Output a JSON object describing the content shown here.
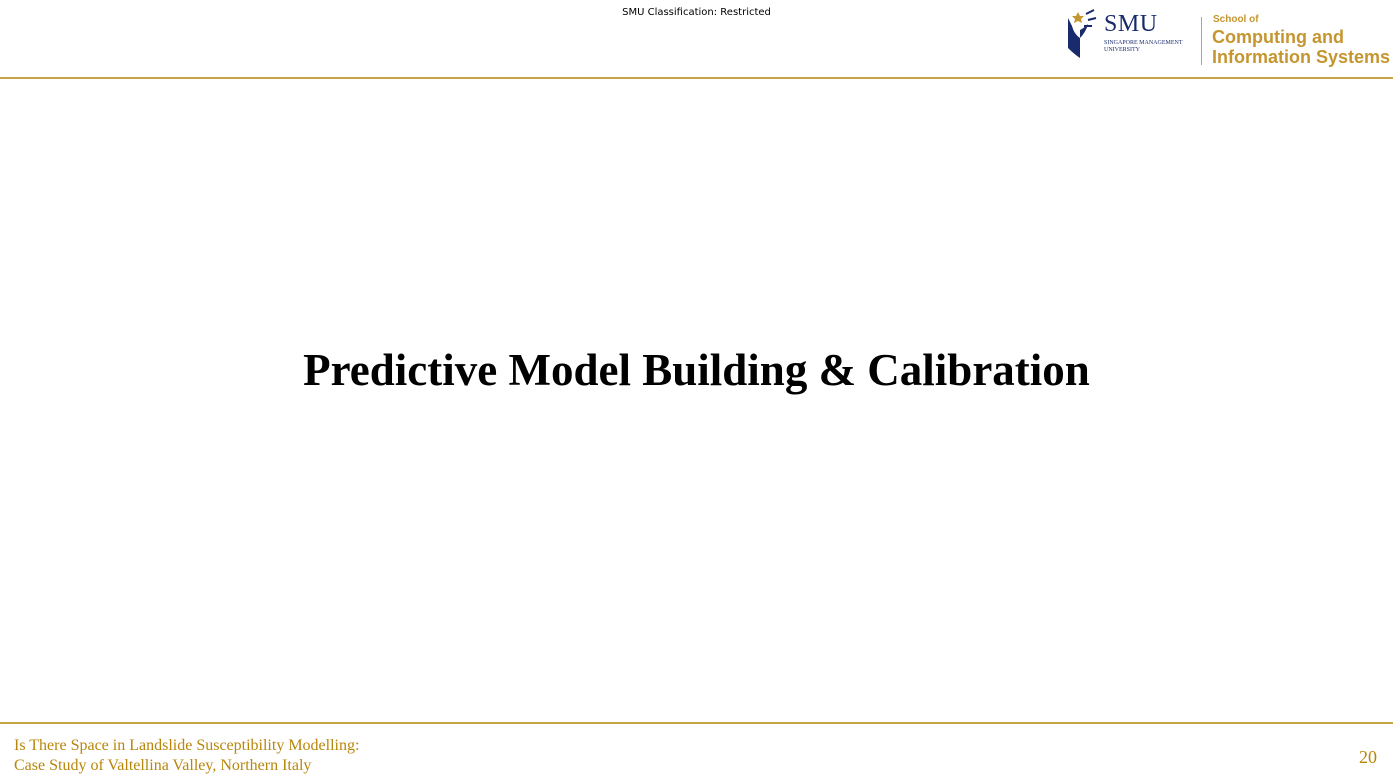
{
  "header": {
    "classification": "SMU Classification: Restricted",
    "logo": {
      "university_short": "SMU",
      "university_full_line1": "SINGAPORE MANAGEMENT",
      "university_full_line2": "UNIVERSITY",
      "school_prefix": "School of",
      "school_line1": "Computing and",
      "school_line2": "Information Systems",
      "emblem_icon": "smu-emblem-icon",
      "brand_navy": "#1a2b6d",
      "brand_gold": "#c5962f"
    }
  },
  "slide": {
    "title": "Predictive Model Building & Calibration"
  },
  "footer": {
    "line1": "Is There Space in Landslide Susceptibility Modelling:",
    "line2": "Case Study of Valtellina Valley, Northern Italy",
    "page_number": "20"
  },
  "colors": {
    "rule": "#c5a544",
    "footer_text": "#b8860b"
  }
}
